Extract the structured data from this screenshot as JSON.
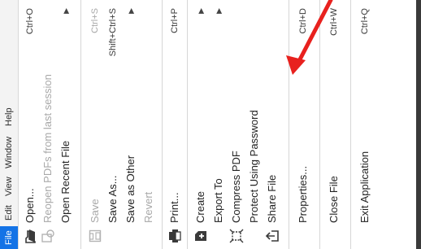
{
  "menubar": {
    "items": [
      "File",
      "Edit",
      "View",
      "Window",
      "Help"
    ]
  },
  "menu": {
    "open": {
      "label": "Open...",
      "shortcut": "Ctrl+O"
    },
    "reopen": {
      "label": "Reopen PDFs from last session"
    },
    "open_recent": {
      "label": "Open Recent File"
    },
    "save": {
      "label": "Save",
      "shortcut": "Ctrl+S"
    },
    "save_as": {
      "label": "Save As...",
      "shortcut": "Shift+Ctrl+S"
    },
    "save_as_other": {
      "label": "Save as Other"
    },
    "revert": {
      "label": "Revert"
    },
    "print": {
      "label": "Print...",
      "shortcut": "Ctrl+P"
    },
    "create": {
      "label": "Create"
    },
    "export_to": {
      "label": "Export To"
    },
    "compress": {
      "label": "Compress PDF"
    },
    "protect": {
      "label": "Protect Using Password"
    },
    "share": {
      "label": "Share File"
    },
    "properties": {
      "label": "Properties...",
      "shortcut": "Ctrl+D"
    },
    "close": {
      "label": "Close File",
      "shortcut": "Ctrl+W"
    },
    "exit": {
      "label": "Exit Application",
      "shortcut": "Ctrl+Q"
    }
  },
  "annotation": {
    "arrow_color": "#e8211e"
  },
  "colors": {
    "accent": "#1473e6"
  }
}
